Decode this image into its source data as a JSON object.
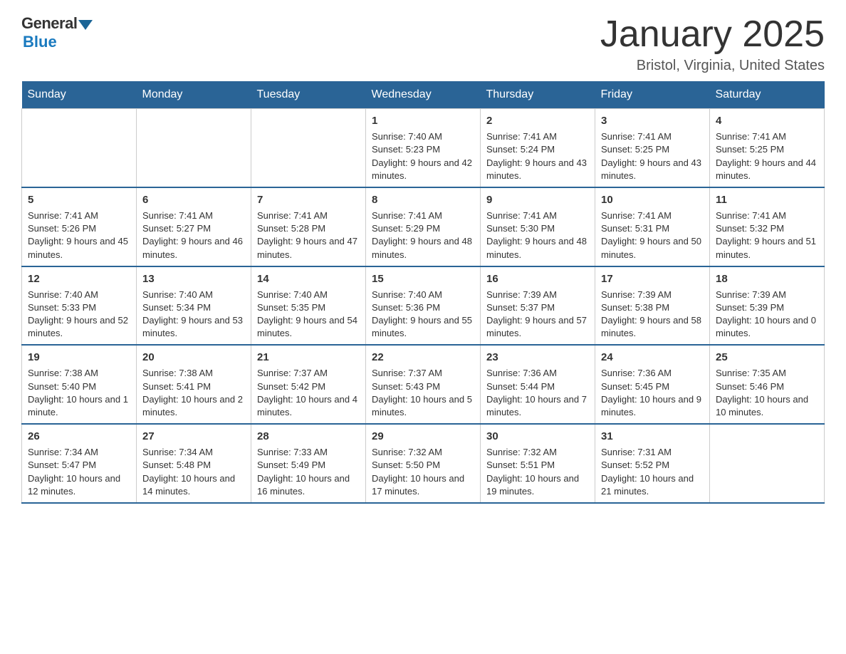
{
  "logo": {
    "general": "General",
    "blue": "Blue"
  },
  "title": "January 2025",
  "subtitle": "Bristol, Virginia, United States",
  "days_of_week": [
    "Sunday",
    "Monday",
    "Tuesday",
    "Wednesday",
    "Thursday",
    "Friday",
    "Saturday"
  ],
  "weeks": [
    [
      {
        "day": "",
        "sunrise": "",
        "sunset": "",
        "daylight": ""
      },
      {
        "day": "",
        "sunrise": "",
        "sunset": "",
        "daylight": ""
      },
      {
        "day": "",
        "sunrise": "",
        "sunset": "",
        "daylight": ""
      },
      {
        "day": "1",
        "sunrise": "Sunrise: 7:40 AM",
        "sunset": "Sunset: 5:23 PM",
        "daylight": "Daylight: 9 hours and 42 minutes."
      },
      {
        "day": "2",
        "sunrise": "Sunrise: 7:41 AM",
        "sunset": "Sunset: 5:24 PM",
        "daylight": "Daylight: 9 hours and 43 minutes."
      },
      {
        "day": "3",
        "sunrise": "Sunrise: 7:41 AM",
        "sunset": "Sunset: 5:25 PM",
        "daylight": "Daylight: 9 hours and 43 minutes."
      },
      {
        "day": "4",
        "sunrise": "Sunrise: 7:41 AM",
        "sunset": "Sunset: 5:25 PM",
        "daylight": "Daylight: 9 hours and 44 minutes."
      }
    ],
    [
      {
        "day": "5",
        "sunrise": "Sunrise: 7:41 AM",
        "sunset": "Sunset: 5:26 PM",
        "daylight": "Daylight: 9 hours and 45 minutes."
      },
      {
        "day": "6",
        "sunrise": "Sunrise: 7:41 AM",
        "sunset": "Sunset: 5:27 PM",
        "daylight": "Daylight: 9 hours and 46 minutes."
      },
      {
        "day": "7",
        "sunrise": "Sunrise: 7:41 AM",
        "sunset": "Sunset: 5:28 PM",
        "daylight": "Daylight: 9 hours and 47 minutes."
      },
      {
        "day": "8",
        "sunrise": "Sunrise: 7:41 AM",
        "sunset": "Sunset: 5:29 PM",
        "daylight": "Daylight: 9 hours and 48 minutes."
      },
      {
        "day": "9",
        "sunrise": "Sunrise: 7:41 AM",
        "sunset": "Sunset: 5:30 PM",
        "daylight": "Daylight: 9 hours and 48 minutes."
      },
      {
        "day": "10",
        "sunrise": "Sunrise: 7:41 AM",
        "sunset": "Sunset: 5:31 PM",
        "daylight": "Daylight: 9 hours and 50 minutes."
      },
      {
        "day": "11",
        "sunrise": "Sunrise: 7:41 AM",
        "sunset": "Sunset: 5:32 PM",
        "daylight": "Daylight: 9 hours and 51 minutes."
      }
    ],
    [
      {
        "day": "12",
        "sunrise": "Sunrise: 7:40 AM",
        "sunset": "Sunset: 5:33 PM",
        "daylight": "Daylight: 9 hours and 52 minutes."
      },
      {
        "day": "13",
        "sunrise": "Sunrise: 7:40 AM",
        "sunset": "Sunset: 5:34 PM",
        "daylight": "Daylight: 9 hours and 53 minutes."
      },
      {
        "day": "14",
        "sunrise": "Sunrise: 7:40 AM",
        "sunset": "Sunset: 5:35 PM",
        "daylight": "Daylight: 9 hours and 54 minutes."
      },
      {
        "day": "15",
        "sunrise": "Sunrise: 7:40 AM",
        "sunset": "Sunset: 5:36 PM",
        "daylight": "Daylight: 9 hours and 55 minutes."
      },
      {
        "day": "16",
        "sunrise": "Sunrise: 7:39 AM",
        "sunset": "Sunset: 5:37 PM",
        "daylight": "Daylight: 9 hours and 57 minutes."
      },
      {
        "day": "17",
        "sunrise": "Sunrise: 7:39 AM",
        "sunset": "Sunset: 5:38 PM",
        "daylight": "Daylight: 9 hours and 58 minutes."
      },
      {
        "day": "18",
        "sunrise": "Sunrise: 7:39 AM",
        "sunset": "Sunset: 5:39 PM",
        "daylight": "Daylight: 10 hours and 0 minutes."
      }
    ],
    [
      {
        "day": "19",
        "sunrise": "Sunrise: 7:38 AM",
        "sunset": "Sunset: 5:40 PM",
        "daylight": "Daylight: 10 hours and 1 minute."
      },
      {
        "day": "20",
        "sunrise": "Sunrise: 7:38 AM",
        "sunset": "Sunset: 5:41 PM",
        "daylight": "Daylight: 10 hours and 2 minutes."
      },
      {
        "day": "21",
        "sunrise": "Sunrise: 7:37 AM",
        "sunset": "Sunset: 5:42 PM",
        "daylight": "Daylight: 10 hours and 4 minutes."
      },
      {
        "day": "22",
        "sunrise": "Sunrise: 7:37 AM",
        "sunset": "Sunset: 5:43 PM",
        "daylight": "Daylight: 10 hours and 5 minutes."
      },
      {
        "day": "23",
        "sunrise": "Sunrise: 7:36 AM",
        "sunset": "Sunset: 5:44 PM",
        "daylight": "Daylight: 10 hours and 7 minutes."
      },
      {
        "day": "24",
        "sunrise": "Sunrise: 7:36 AM",
        "sunset": "Sunset: 5:45 PM",
        "daylight": "Daylight: 10 hours and 9 minutes."
      },
      {
        "day": "25",
        "sunrise": "Sunrise: 7:35 AM",
        "sunset": "Sunset: 5:46 PM",
        "daylight": "Daylight: 10 hours and 10 minutes."
      }
    ],
    [
      {
        "day": "26",
        "sunrise": "Sunrise: 7:34 AM",
        "sunset": "Sunset: 5:47 PM",
        "daylight": "Daylight: 10 hours and 12 minutes."
      },
      {
        "day": "27",
        "sunrise": "Sunrise: 7:34 AM",
        "sunset": "Sunset: 5:48 PM",
        "daylight": "Daylight: 10 hours and 14 minutes."
      },
      {
        "day": "28",
        "sunrise": "Sunrise: 7:33 AM",
        "sunset": "Sunset: 5:49 PM",
        "daylight": "Daylight: 10 hours and 16 minutes."
      },
      {
        "day": "29",
        "sunrise": "Sunrise: 7:32 AM",
        "sunset": "Sunset: 5:50 PM",
        "daylight": "Daylight: 10 hours and 17 minutes."
      },
      {
        "day": "30",
        "sunrise": "Sunrise: 7:32 AM",
        "sunset": "Sunset: 5:51 PM",
        "daylight": "Daylight: 10 hours and 19 minutes."
      },
      {
        "day": "31",
        "sunrise": "Sunrise: 7:31 AM",
        "sunset": "Sunset: 5:52 PM",
        "daylight": "Daylight: 10 hours and 21 minutes."
      },
      {
        "day": "",
        "sunrise": "",
        "sunset": "",
        "daylight": ""
      }
    ]
  ]
}
